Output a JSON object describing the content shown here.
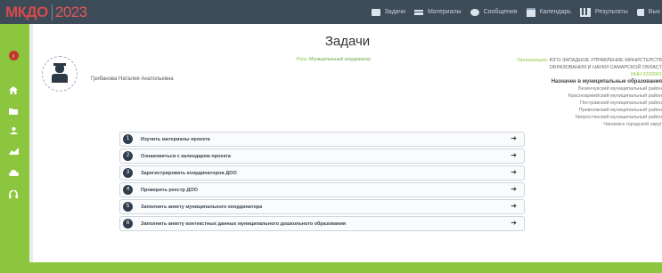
{
  "header": {
    "logo_text": "МКДО",
    "logo_year": "2023",
    "nav": [
      {
        "label": "Задачи",
        "icon": "tasks-icon"
      },
      {
        "label": "Материалы",
        "icon": "list-icon"
      },
      {
        "label": "Сообщения",
        "icon": "chat-icon"
      },
      {
        "label": "Календарь",
        "icon": "calendar-icon"
      },
      {
        "label": "Результаты",
        "icon": "chart-icon"
      },
      {
        "label": "Вых",
        "icon": "key-icon"
      }
    ]
  },
  "sidebar": {
    "items": [
      {
        "icon": "arrow-right-icon"
      },
      {
        "icon": "home-icon"
      },
      {
        "icon": "folder-icon"
      },
      {
        "icon": "users-icon"
      },
      {
        "icon": "stats-icon"
      },
      {
        "icon": "cloud-upload-icon"
      },
      {
        "icon": "headset-icon"
      }
    ]
  },
  "page": {
    "title": "Задачи",
    "user_name": "Грибанова Наталия Анатольевна",
    "role_key": "Роль:",
    "role_value": "Муниципальный координатор",
    "org_key": "Организация:",
    "org_line1": "ЮГО-ЗАПАДНОЕ УПРАВЛЕНИЕ МИНИСТЕРСТВ",
    "org_line2": "ОБРАЗОВАНИЯ И НАУКИ САМАРСКОЙ ОБЛАСТ",
    "inn": "ИНН 6320001",
    "assigned_title": "Назначен в муниципальные образования",
    "assigned": [
      "Безенчукский муниципальный район",
      "Красноармейский муниципальный район",
      "Пестравский муниципальный район",
      "Приволжский муниципальный район",
      "Хворостянский муниципальный район",
      "Чапаевск городской округ"
    ]
  },
  "tasks": [
    {
      "num": "1",
      "label": "Изучить материалы проекта"
    },
    {
      "num": "2",
      "label": "Ознакомиться с календарем проекта"
    },
    {
      "num": "3",
      "label": "Зарегистрировать координаторов ДОО"
    },
    {
      "num": "4",
      "label": "Проверить реестр ДОО"
    },
    {
      "num": "5",
      "label": "Заполнить анкету муниципального координатора"
    },
    {
      "num": "6",
      "label": "Заполнить анкету контекстных данных муниципального дошкольного образования"
    }
  ],
  "task_arrow": "➔"
}
